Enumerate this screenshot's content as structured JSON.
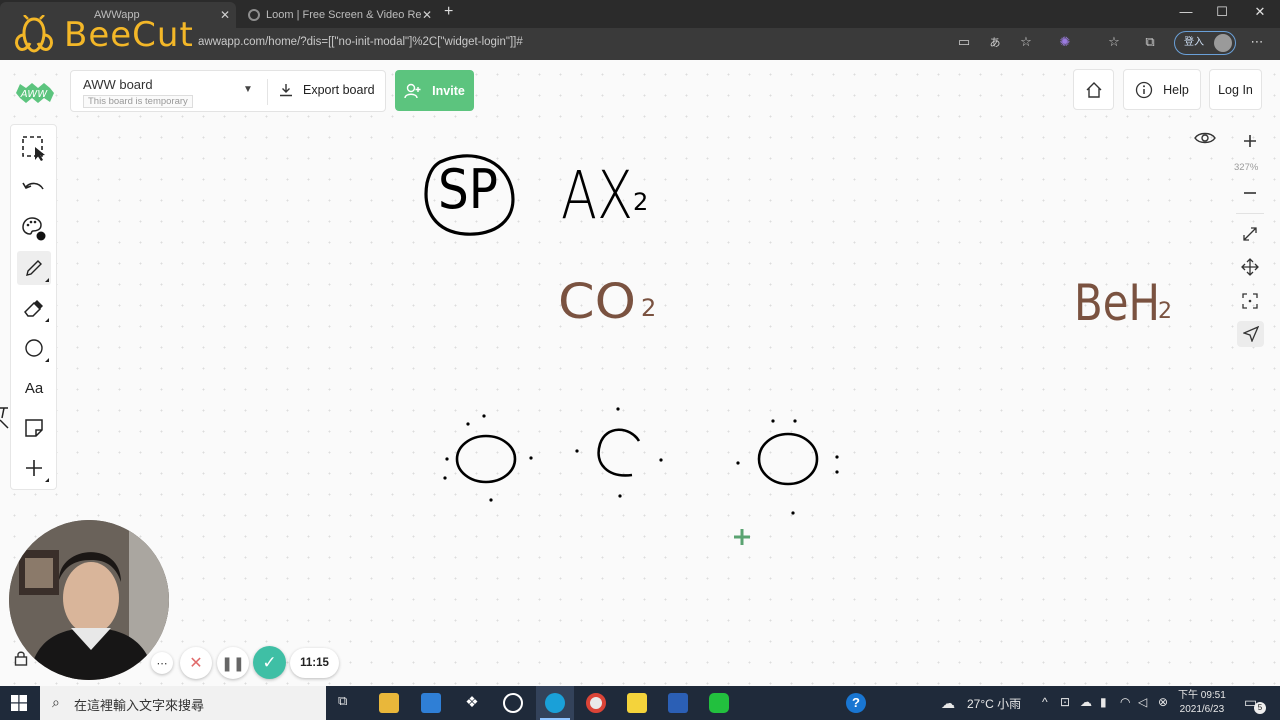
{
  "browser": {
    "tabs": [
      {
        "title": "AWWapp",
        "active": true
      },
      {
        "title": "Loom | Free Screen & Video Re",
        "active": false
      }
    ],
    "url": "awwapp.com/home/?dis=[[\"no-init-modal\"]%2C[\"widget-login\"]]#",
    "login_label": "登入"
  },
  "watermark": {
    "text": "BeeCut"
  },
  "header": {
    "logo_text": "AWW",
    "board_name": "AWW board",
    "board_badge": "This board is temporary",
    "export_label": "Export board",
    "invite_label": "Invite",
    "help_label": "Help",
    "login_label": "Log In"
  },
  "toolbar": {
    "text_tool_label": "Aa"
  },
  "zoom": {
    "level": "327%"
  },
  "canvas": {
    "sp_label": "SP",
    "ax_label": "AX",
    "ax_sub": "2",
    "co_label": "CO",
    "co_sub": "2",
    "beh_label": "BeH",
    "beh_sub": "2",
    "lewis": {
      "left": "O",
      "center": "C",
      "right": "O"
    }
  },
  "recorder": {
    "timer": "11:15"
  },
  "taskbar": {
    "search_placeholder": "在這裡輸入文字來搜尋",
    "weather": "27°C 小雨",
    "time": "下午 09:51",
    "date": "2021/6/23",
    "notif_count": "5"
  },
  "colors": {
    "invite_green": "#5cc47e",
    "beecut_gold": "#f3b728",
    "brown_ink": "#7a5240",
    "taskbar_bg": "#1f2a3a"
  }
}
